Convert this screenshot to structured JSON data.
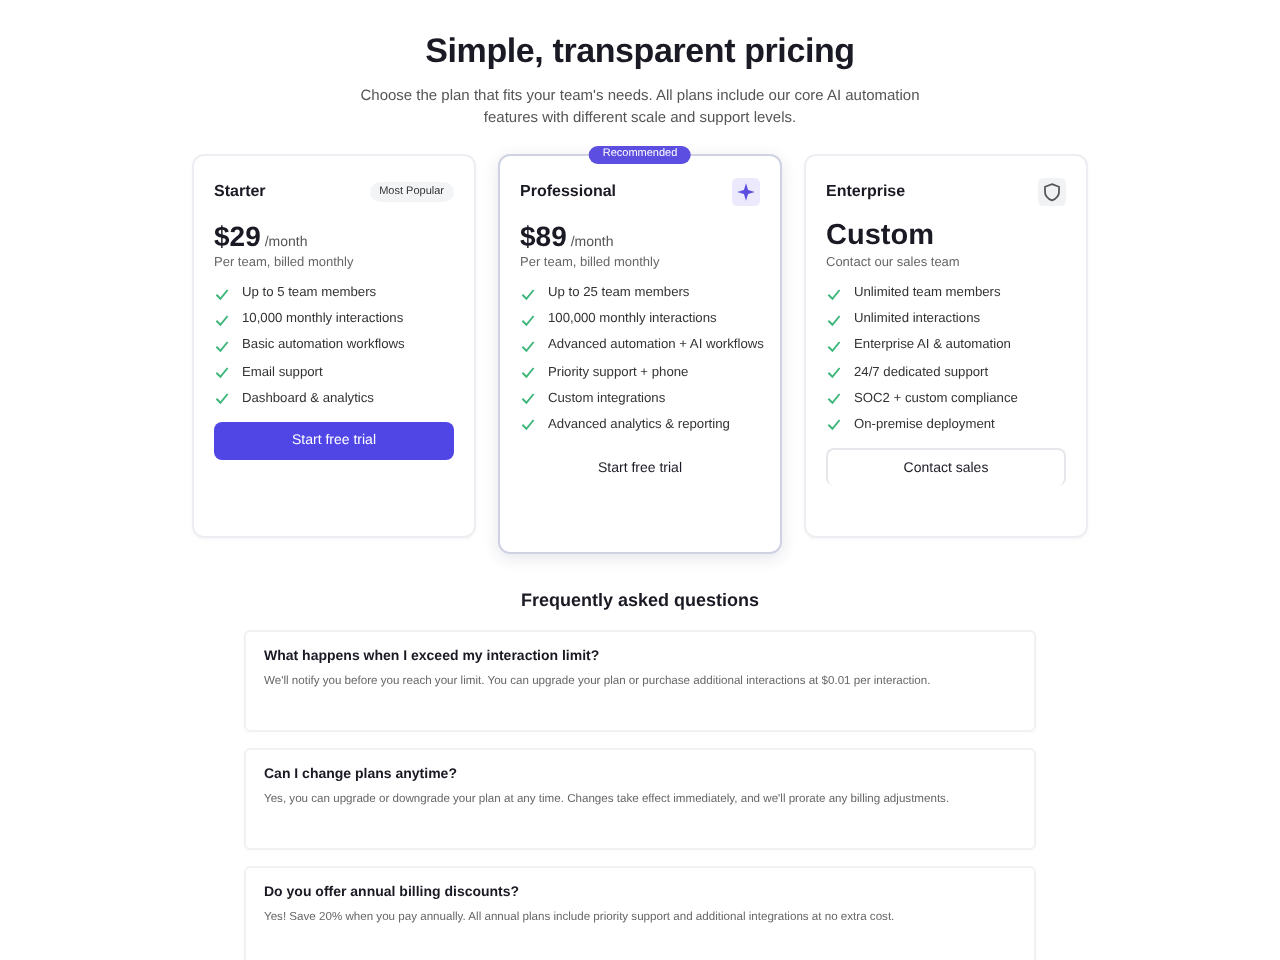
{
  "header": {
    "title": "Simple, transparent pricing",
    "subtitle": "Choose the plan that fits your team's needs. All plans include our core AI automation features with different scale and support levels."
  },
  "plans": [
    {
      "name": "Starter",
      "featured": false,
      "badge": "Most Popular",
      "kind": "starter",
      "price": "$29",
      "period": "/month",
      "note": "Per team, billed monthly",
      "features": [
        "Up to 5 team members",
        "10,000 monthly interactions",
        "Basic automation workflows",
        "Email support",
        "Dashboard & analytics"
      ],
      "button": {
        "label": "Start free trial",
        "kind": "primary"
      }
    },
    {
      "name": "Professional",
      "featured": true,
      "ribbon": "Recommended",
      "kind": "professional",
      "price": "$89",
      "period": "/month",
      "note": "Per team, billed monthly",
      "features": [
        "Up to 25 team members",
        "100,000 monthly interactions",
        "Advanced automation + AI workflows",
        "Priority support + phone",
        "Custom integrations",
        "Advanced analytics & reporting"
      ],
      "button": {
        "label": "Start free trial",
        "kind": "ghost"
      }
    },
    {
      "name": "Enterprise",
      "featured": false,
      "kind": "enterprise",
      "price": "Custom",
      "note": "Contact our sales team",
      "features": [
        "Unlimited team members",
        "Unlimited interactions",
        "Enterprise AI & automation",
        "24/7 dedicated support",
        "SOC2 + custom compliance",
        "On-premise deployment"
      ],
      "button": {
        "label": "Contact sales",
        "kind": "outline"
      }
    }
  ],
  "faq": {
    "title": "Frequently asked questions",
    "items": [
      {
        "question": "What happens when I exceed my interaction limit?",
        "answer": "We'll notify you before you reach your limit. You can upgrade your plan or purchase additional interactions at $0.01 per interaction."
      },
      {
        "question": "Can I change plans anytime?",
        "answer": "Yes, you can upgrade or downgrade your plan at any time. Changes take effect immediately, and we'll prorate any billing adjustments."
      },
      {
        "question": "Do you offer annual billing discounts?",
        "answer": "Yes! Save 20% when you pay annually. All annual plans include priority support and additional integrations at no extra cost."
      }
    ]
  }
}
